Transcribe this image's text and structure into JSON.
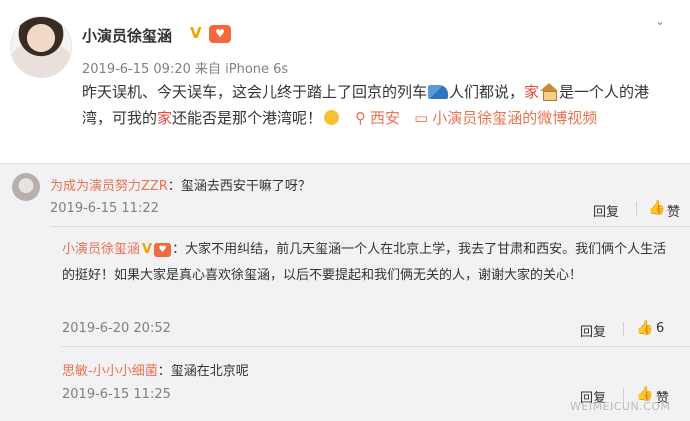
{
  "post": {
    "author_name": "小演员徐玺涵",
    "verified_mark": "V",
    "level_badge": "♥",
    "meta": "2019-6-15 09:20  来自 iPhone 6s",
    "text_a": "昨天误机、今天误车，这会儿终于踏上了回京的列车",
    "text_b": "人们都说，",
    "text_home1": "家",
    "text_c": "是一个人的港湾，可我的",
    "text_home2": "家",
    "text_d": "还能否是那个港湾呢！",
    "location_label": "西安",
    "video_label": "小演员徐玺涵的微博视频"
  },
  "comments": [
    {
      "author": "为成为演员努力ZZR",
      "text": "：玺涵去西安干嘛了呀？",
      "time": "2019-6-15 11:22",
      "reply_label": "回复",
      "like_label": "赞"
    }
  ],
  "replies": [
    {
      "author": "小演员徐玺涵",
      "text": "：大家不用纠结，前几天玺涵一个人在北京上学，我去了甘肃和西安。我们俩个人生活的挺好！如果大家是真心喜欢徐玺涵，以后不要提起和我们俩无关的人，谢谢大家的关心！",
      "time": "2019-6-20 20:52",
      "reply_label": "回复",
      "like_count": "6"
    },
    {
      "author": "思敏-小小小细菌",
      "text": "：玺涵在北京呢",
      "time": "2019-6-15 11:25",
      "reply_label": "回复",
      "like_label": "赞"
    }
  ],
  "watermark": "WEIMEICUN.COM",
  "colors": {
    "link": "#eb7350",
    "red": "#e24b3b",
    "comments_bg": "#f2f2f5"
  }
}
